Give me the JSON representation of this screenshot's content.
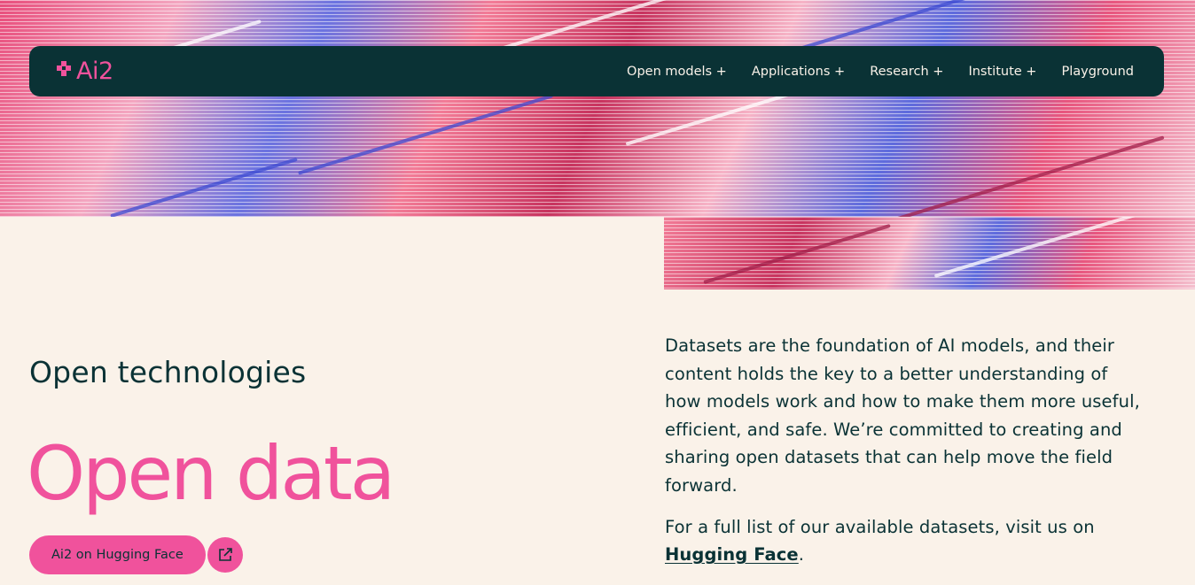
{
  "brand": {
    "logo_text": "Ai2",
    "accent": "#F0529C",
    "dark": "#0A3235",
    "background": "#FAF2E9"
  },
  "nav": {
    "items": [
      {
        "label": "Open models +"
      },
      {
        "label": "Applications +"
      },
      {
        "label": "Research +"
      },
      {
        "label": "Institute +"
      },
      {
        "label": "Playground"
      }
    ]
  },
  "hero": {
    "eyebrow": "Open technologies",
    "title": "Open data",
    "cta_label": "Ai2 on Hugging Face",
    "cta_icon": "external-link-icon"
  },
  "content": {
    "paragraph1": "Datasets are the foundation of AI models, and their content holds the key to a better understanding of how models work and how to make them more useful, efficient, and safe. We’re committed to creating and sharing open datasets that can help move the field forward.",
    "paragraph2_prefix": "For a full list of our available datasets, visit us on ",
    "paragraph2_link": "Hugging Face",
    "paragraph2_suffix": "."
  }
}
